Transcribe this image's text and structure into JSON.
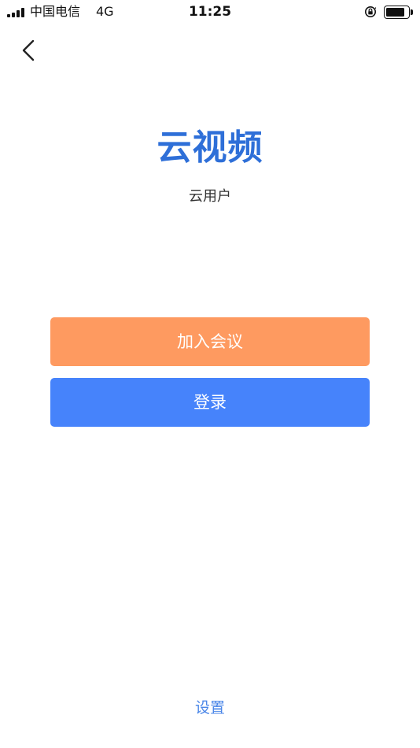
{
  "status_bar": {
    "carrier": "中国电信",
    "network": "4G",
    "time": "11:25",
    "battery_level": 0.85,
    "icons": [
      "signal-icon",
      "orientation-lock-icon",
      "battery-icon"
    ]
  },
  "nav": {
    "back_icon": "chevron-left-icon"
  },
  "app": {
    "title": "云视频",
    "subtitle": "云用户"
  },
  "actions": {
    "join_label": "加入会议",
    "login_label": "登录"
  },
  "footer": {
    "settings_label": "设置"
  },
  "colors": {
    "title": "#2e6fd8",
    "join_button": "#fe9a60",
    "login_button": "#4683fb",
    "settings_link": "#4a86e8"
  }
}
